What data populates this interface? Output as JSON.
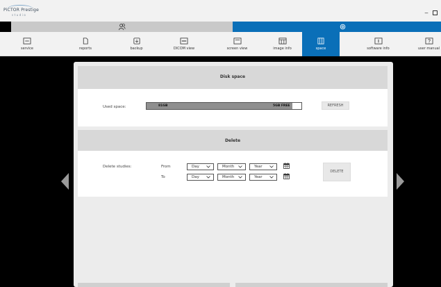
{
  "app": {
    "logo_main": "PiCTOR Prestige",
    "logo_sub": "studio"
  },
  "groups": {
    "left_icon": "users-icon",
    "right_icon": "gear-icon"
  },
  "toolbar": {
    "items": [
      {
        "label": "service",
        "icon": "service-icon"
      },
      {
        "label": "reports",
        "icon": "reports-icon"
      },
      {
        "label": "backup",
        "icon": "backup-icon"
      },
      {
        "label": "DICOM view",
        "icon": "dicom-view-icon"
      },
      {
        "label": "screen view",
        "icon": "screen-view-icon"
      },
      {
        "label": "image info",
        "icon": "image-info-icon"
      },
      {
        "label": "space",
        "icon": "space-icon"
      },
      {
        "label": "software info",
        "icon": "software-info-icon"
      },
      {
        "label": "user manual",
        "icon": "user-manual-icon"
      }
    ],
    "active": "space"
  },
  "disk": {
    "title": "Disk space",
    "used_label": "Used space:",
    "used_text": "81GB",
    "free_text": "5GB FREE",
    "used_fraction": 0.94,
    "refresh_label": "REFRESH"
  },
  "delete": {
    "title": "Delete",
    "label": "Delete studies:",
    "from_label": "From",
    "to_label": "To",
    "day": "Day",
    "month": "Month",
    "year": "Year",
    "button_label": "DELETE"
  },
  "colors": {
    "accent": "#0a6fb8",
    "bar_used": "#8f8f8f"
  }
}
